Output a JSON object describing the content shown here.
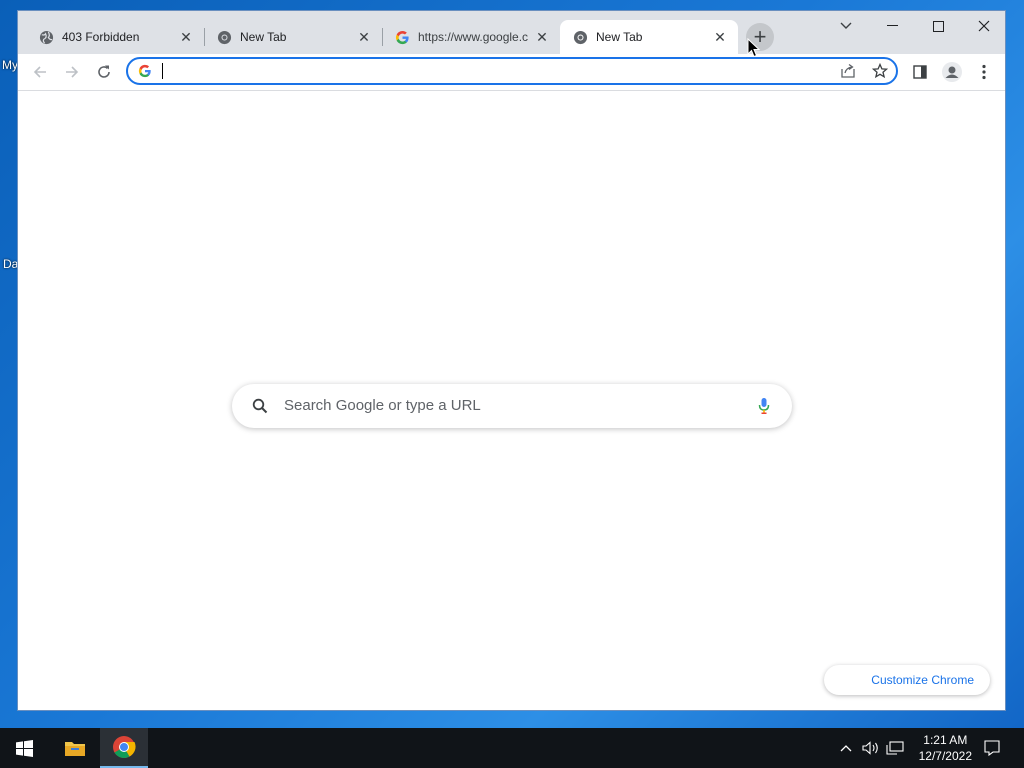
{
  "desktop": {
    "icon_label_1": "My",
    "icon_label_2": "Da"
  },
  "tabs": [
    {
      "title": "403 Forbidden",
      "icon": "globe-icon",
      "active": false
    },
    {
      "title": "New Tab",
      "icon": "chrome-icon",
      "active": false
    },
    {
      "title": "https://www.google.c",
      "icon": "google-icon",
      "active": false
    },
    {
      "title": "New Tab",
      "icon": "chrome-icon",
      "active": true
    }
  ],
  "window_controls": {
    "tab_search": "chevron-down-icon",
    "minimize": "minimize-icon",
    "maximize": "maximize-icon",
    "close": "close-icon"
  },
  "omnibox": {
    "value": "",
    "placeholder": ""
  },
  "content": {
    "search_placeholder": "Search Google or type a URL",
    "customize_label": "Customize Chrome"
  },
  "taskbar": {
    "time": "1:21 AM",
    "date": "12/7/2022"
  },
  "colors": {
    "accent": "#1a73e8",
    "tabstrip": "#dee1e6",
    "taskbar": "#101418"
  }
}
